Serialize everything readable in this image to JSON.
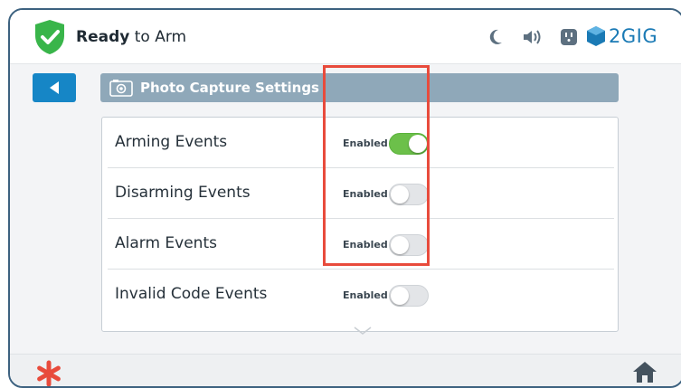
{
  "status": {
    "state_bold": "Ready",
    "state_rest": " to Arm",
    "shield_color": "#39b54a",
    "icons": [
      "moon-icon",
      "speaker-icon",
      "outlet-icon"
    ]
  },
  "brand": {
    "name": "2GIG",
    "color": "#1a7ab5"
  },
  "header": {
    "back_icon": "back-arrow-icon",
    "title": "Photo Capture Settings",
    "title_icon": "camera-icon"
  },
  "settings": {
    "rows": [
      {
        "label": "Arming Events",
        "state": "Enabled",
        "on": true
      },
      {
        "label": "Disarming Events",
        "state": "Enabled",
        "on": false
      },
      {
        "label": "Alarm Events",
        "state": "Enabled",
        "on": false
      },
      {
        "label": "Invalid Code Events",
        "state": "Enabled",
        "on": false
      }
    ]
  },
  "footer": {
    "emergency_icon": "emergency-asterisk-icon",
    "home_icon": "home-icon"
  },
  "colors": {
    "accent_blue": "#1686c6",
    "toggle_on": "#6cc04a",
    "highlight_red": "#e84b3c"
  }
}
